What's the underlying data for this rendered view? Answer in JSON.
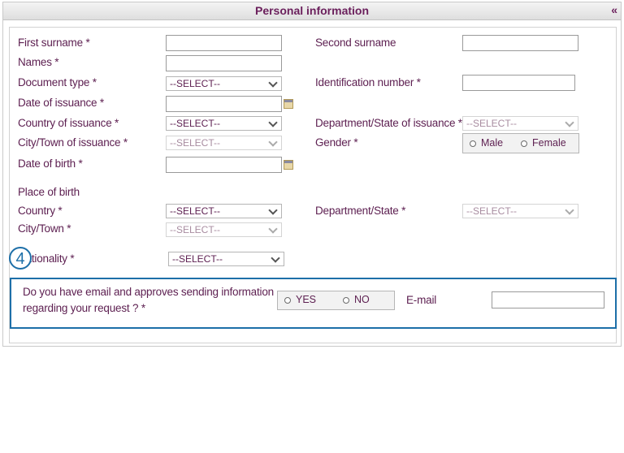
{
  "header": {
    "title": "Personal information",
    "collapse": "«"
  },
  "fields": {
    "first_surname": "First surname *",
    "second_surname": "Second surname",
    "names": "Names *",
    "document_type": "Document type *",
    "identification_number": "Identification number *",
    "date_of_issuance": "Date of issuance *",
    "country_of_issuance": "Country of issuance *",
    "department_state_of_issuance": "Department/State of issuance *",
    "city_town_of_issuance": "City/Town of issuance *",
    "gender": "Gender *",
    "date_of_birth": "Date of birth *",
    "place_of_birth": "Place of birth",
    "country": "Country *",
    "department_state": "Department/State *",
    "city_town": "City/Town *",
    "nationality": "Nationality *"
  },
  "select_placeholder": "--SELECT--",
  "gender_options": {
    "male": "Male",
    "female": "Female"
  },
  "email_question": {
    "line1": "Do you have email and approves sending information",
    "line2": "regarding your request ? *",
    "yes": "YES",
    "no": "NO",
    "email_label": "E-mail"
  },
  "step_badge": "4",
  "colors": {
    "label": "#5e2152",
    "accent": "#1d6fa8",
    "title": "#6b1f5c"
  }
}
